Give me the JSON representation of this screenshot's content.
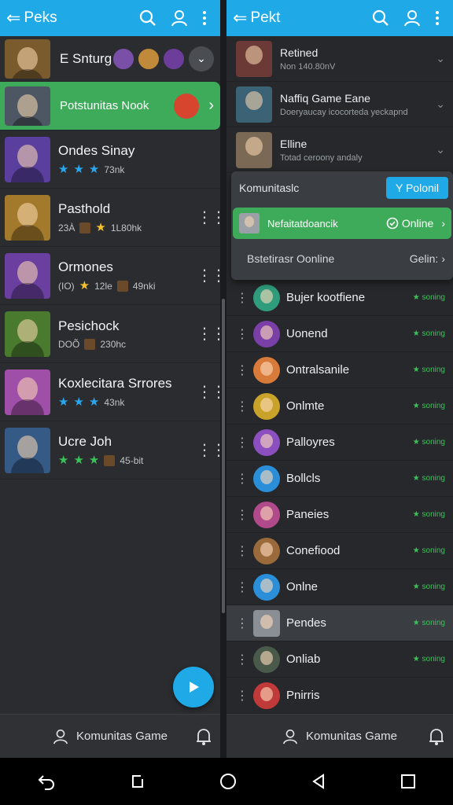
{
  "left": {
    "title": "Peks",
    "first_row": {
      "name": "E Snturg",
      "avatars": [
        "#7a4fa8",
        "#c08a3a",
        "#6c3d9a"
      ],
      "thumb": "#7a5b2e"
    },
    "highlight": {
      "name": "Potstunitas Nook",
      "thumb": "#4d5763",
      "avatar": "#d8452f"
    },
    "games": [
      {
        "name": "Ondes Sinay",
        "meta": "73nk",
        "stars": [
          "blue",
          "blue",
          "blue"
        ],
        "thumb": "#5a3f9e"
      },
      {
        "name": "Pasthold",
        "pre": "23À",
        "meta": "1L80hk",
        "stars": [
          "gold"
        ],
        "thumb": "#a37a2c"
      },
      {
        "name": "Ormones",
        "pre": "(IO)",
        "meta": "12le",
        "meta2": "49nki",
        "stars": [
          "gold"
        ],
        "thumb": "#6a3fa0"
      },
      {
        "name": "Pesichock",
        "pre": "DOÕ",
        "meta": "230hc",
        "stars": [],
        "thumb": "#4a7a2e"
      },
      {
        "name": "Koxlecitara Srrores",
        "meta": "43nk",
        "stars": [
          "blue",
          "blue",
          "blue"
        ],
        "thumb": "#a04fa8"
      },
      {
        "name": "Ucre Joh",
        "meta": "45-bit",
        "stars": [
          "green",
          "green",
          "green"
        ],
        "thumb": "#355a86"
      }
    ],
    "bottom_label": "Komunitas Game"
  },
  "right": {
    "title": "Pekt",
    "recent": [
      {
        "name": "Retined",
        "sub": "Non 140.80nV",
        "thumb": "#6b3a36"
      },
      {
        "name": "Naffiq Game Eane",
        "sub": "Doeryaucay icocorteda yeckapnd",
        "thumb": "#3b6275"
      },
      {
        "name": "Elline",
        "sub": "Totad ceroony andaly",
        "thumb": "#7a6a55"
      }
    ],
    "panel": {
      "label": "Komunitaslc",
      "button": "Y Polonil",
      "friend_name": "Nefaitatdoancik",
      "friend_status": "Online",
      "footer_left": "Bstetirasr Oonline",
      "footer_right": "Gelin:"
    },
    "friends": [
      {
        "name": "Bujer kootfiene",
        "status": "★ soning",
        "color": "#2f9c7c"
      },
      {
        "name": "Uonend",
        "status": "★ soning",
        "color": "#7b3fa8"
      },
      {
        "name": "Ontralsanile",
        "status": "★ soning",
        "color": "#d87a3a"
      },
      {
        "name": "Onlmte",
        "status": "★ soning",
        "color": "#c9a22a"
      },
      {
        "name": "Palloyres",
        "status": "★ soning",
        "color": "#8b4fc0"
      },
      {
        "name": "Bollcls",
        "status": "★ soning",
        "color": "#2a8fd8"
      },
      {
        "name": "Paneies",
        "status": "★ soning",
        "color": "#b04a8a"
      },
      {
        "name": "Conefiood",
        "status": "★ soning",
        "color": "#9a6a3a"
      },
      {
        "name": "Onlne",
        "status": "★ soning",
        "color": "#2a8fd8"
      },
      {
        "name": "Pendes",
        "status": "★ soning",
        "color": "#8a8f96"
      },
      {
        "name": "Onliab",
        "status": "★ soning",
        "color": "#4a5a4a"
      },
      {
        "name": "Pnirris",
        "status": "",
        "color": "#c03a3a"
      }
    ],
    "bottom_label": "Komunitas Game"
  },
  "colors": {
    "accent": "#1fa9e6",
    "green": "#3dab59"
  }
}
